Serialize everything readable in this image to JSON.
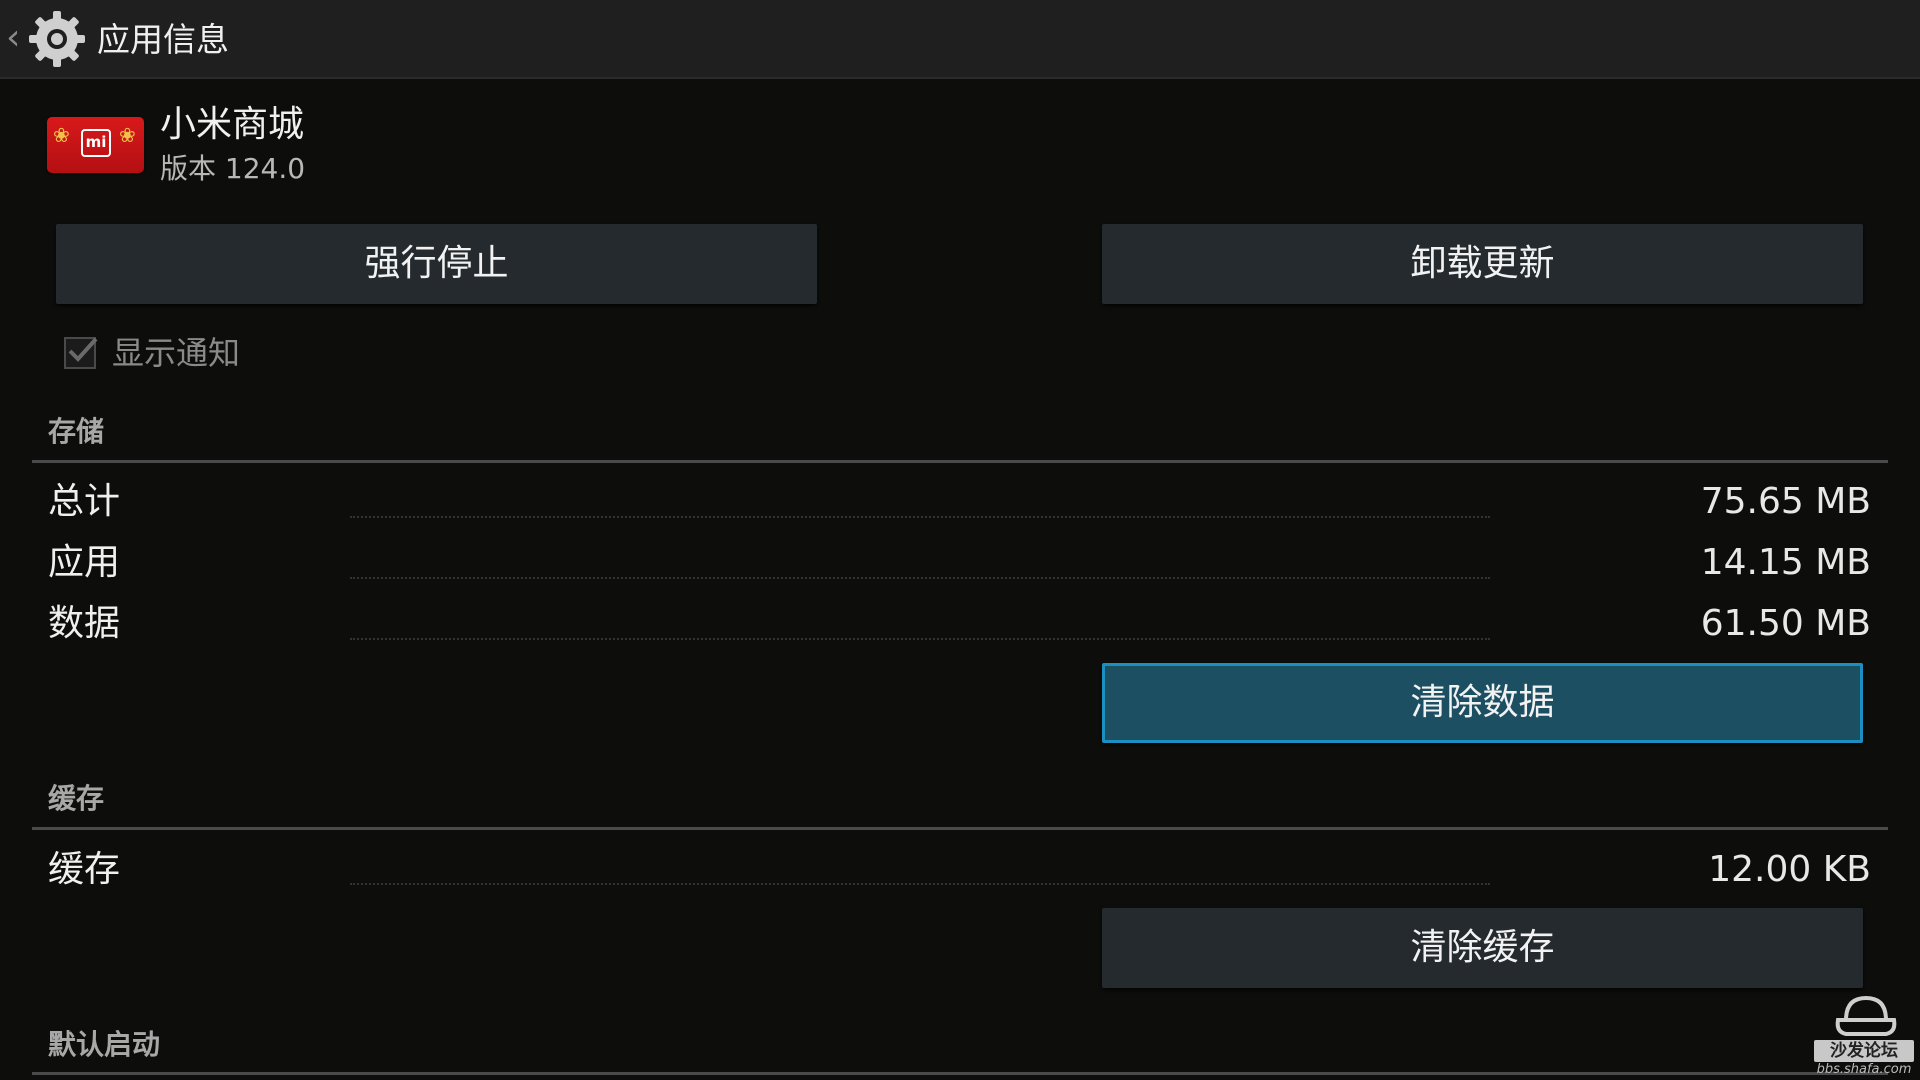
{
  "header": {
    "title": "应用信息",
    "back_icon": "chevron-left-icon",
    "settings_icon": "gear-icon"
  },
  "app": {
    "name": "小米商城",
    "version": "版本 124.0",
    "icon_text": "mi",
    "icon_color": "#d8191b"
  },
  "actions": {
    "force_stop_label": "强行停止",
    "uninstall_updates_label": "卸载更新"
  },
  "notifications": {
    "label": "显示通知",
    "checked": true
  },
  "storage": {
    "header": "存储",
    "rows": [
      {
        "label": "总计",
        "value": "75.65 MB"
      },
      {
        "label": "应用",
        "value": "14.15 MB"
      },
      {
        "label": "数据",
        "value": "61.50 MB"
      }
    ],
    "clear_data_label": "清除数据"
  },
  "cache": {
    "header": "缓存",
    "rows": [
      {
        "label": "缓存",
        "value": "12.00 KB"
      }
    ],
    "clear_cache_label": "清除缓存"
  },
  "launch": {
    "header": "默认启动"
  },
  "watermark": {
    "badge": "沙发论坛",
    "url": "bbs.shafa.com"
  },
  "colors": {
    "focus_accent": "#1b8fc0",
    "button_bg": "#252a2f"
  }
}
